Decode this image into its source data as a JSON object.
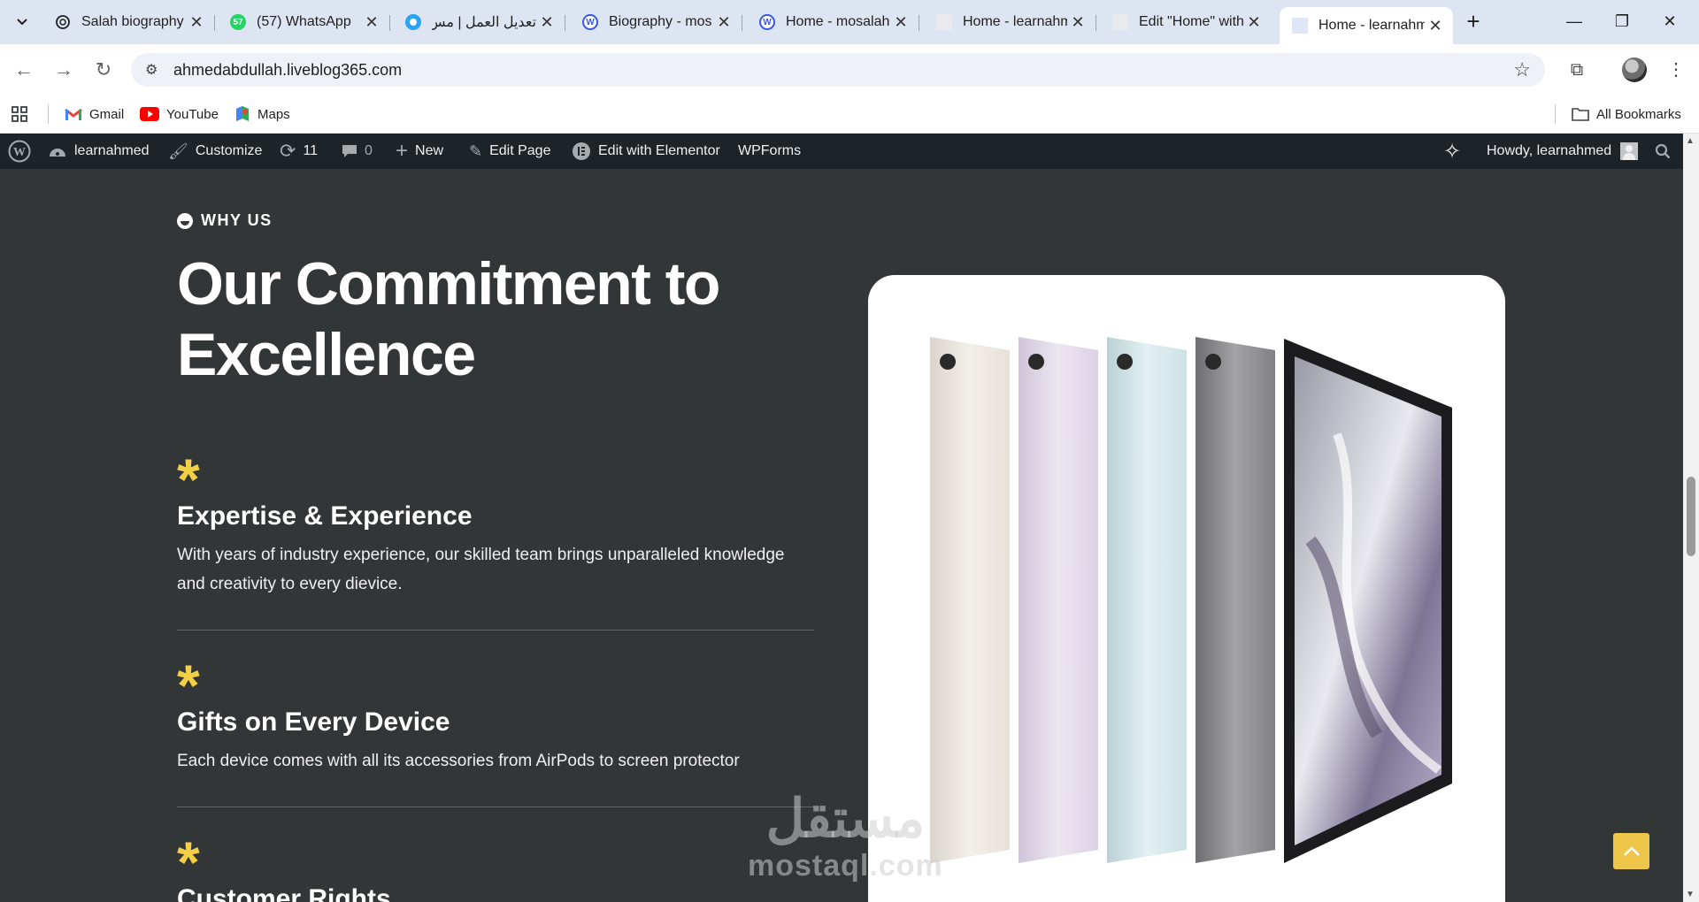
{
  "browser": {
    "tabs": [
      {
        "title": "Salah biography",
        "icon": "openai-icon"
      },
      {
        "title": "(57) WhatsApp",
        "icon": "whatsapp-icon",
        "badge": "57"
      },
      {
        "title": "تعديل العمل | مس",
        "icon": "mostaql-icon"
      },
      {
        "title": "Biography - mos",
        "icon": "wordpress-icon"
      },
      {
        "title": "Home - mosalah",
        "icon": "wordpress-icon"
      },
      {
        "title": "Home - learnahm",
        "icon": "page-icon"
      },
      {
        "title": "Edit \"Home\" with",
        "icon": "page-icon"
      },
      {
        "title": "Home - learnahm",
        "icon": "page-icon",
        "active": true
      }
    ],
    "url": "ahmedabdullah.liveblog365.com",
    "bookmarks": [
      {
        "label": "Gmail",
        "icon": "gmail-icon"
      },
      {
        "label": "YouTube",
        "icon": "youtube-icon"
      },
      {
        "label": "Maps",
        "icon": "maps-icon"
      }
    ],
    "all_bookmarks": "All Bookmarks"
  },
  "adminbar": {
    "site_name": "learnahmed",
    "customize": "Customize",
    "updates_count": "11",
    "comments_count": "0",
    "new": "New",
    "edit_page": "Edit Page",
    "edit_elementor": "Edit with Elementor",
    "wpforms": "WPForms",
    "howdy": "Howdy, learnahmed"
  },
  "section": {
    "eyebrow": "WHY US",
    "headline_line1": "Our Commitment to",
    "headline_line2": "Excellence",
    "features": [
      {
        "marker": "*",
        "title": "Expertise & Experience",
        "text": "With years of industry experience, our skilled team brings unparalleled knowledge and creativity to every dievice."
      },
      {
        "marker": "*",
        "title": "Gifts on Every Device",
        "text": "Each device comes with all its accessories from AirPods to screen protector"
      },
      {
        "marker": "*",
        "title": "Customer Rights",
        "text": ""
      }
    ],
    "accent_color": "#f2cf45",
    "background_color": "#323637"
  },
  "watermark": {
    "arabic": "مستقل",
    "latin": "mostaql.com"
  }
}
